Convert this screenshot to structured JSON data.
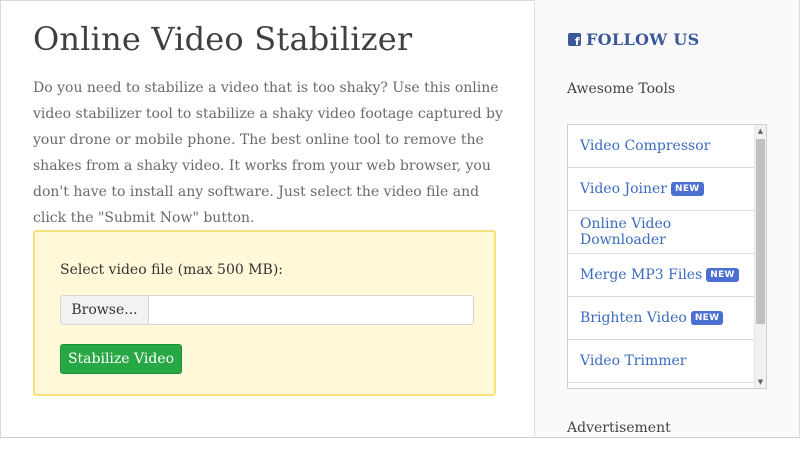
{
  "main": {
    "title": "Online Video Stabilizer",
    "intro": "Do you need to stabilize a video that is too shaky? Use this online video stabilizer tool to stabilize a shaky video footage captured by your drone or mobile phone. The best online tool to remove the shakes from a shaky video. It works from your web browser, you don't have to install any software. Just select the video file and click the \"Submit Now\" button.",
    "upload": {
      "label": "Select video file (max 500 MB):",
      "browse_label": "Browse...",
      "file_value": "",
      "submit_label": "Stabilize Video"
    }
  },
  "sidebar": {
    "follow_label": "FOLLOW US",
    "follow_icon": "facebook-icon",
    "tools_heading": "Awesome Tools",
    "tools": [
      {
        "label": "Video Compressor",
        "badge": ""
      },
      {
        "label": "Video Joiner",
        "badge": "NEW"
      },
      {
        "label": "Online Video Downloader",
        "badge": ""
      },
      {
        "label": "Merge MP3 Files",
        "badge": "NEW"
      },
      {
        "label": "Brighten Video",
        "badge": "NEW"
      },
      {
        "label": "Video Trimmer",
        "badge": ""
      }
    ],
    "ad_heading": "Advertisement"
  },
  "colors": {
    "accent_green": "#28a745",
    "link_blue": "#3a6bbf",
    "facebook_blue": "#3b5998",
    "upload_bg": "#fff8d9",
    "upload_border": "#f5e27c"
  }
}
